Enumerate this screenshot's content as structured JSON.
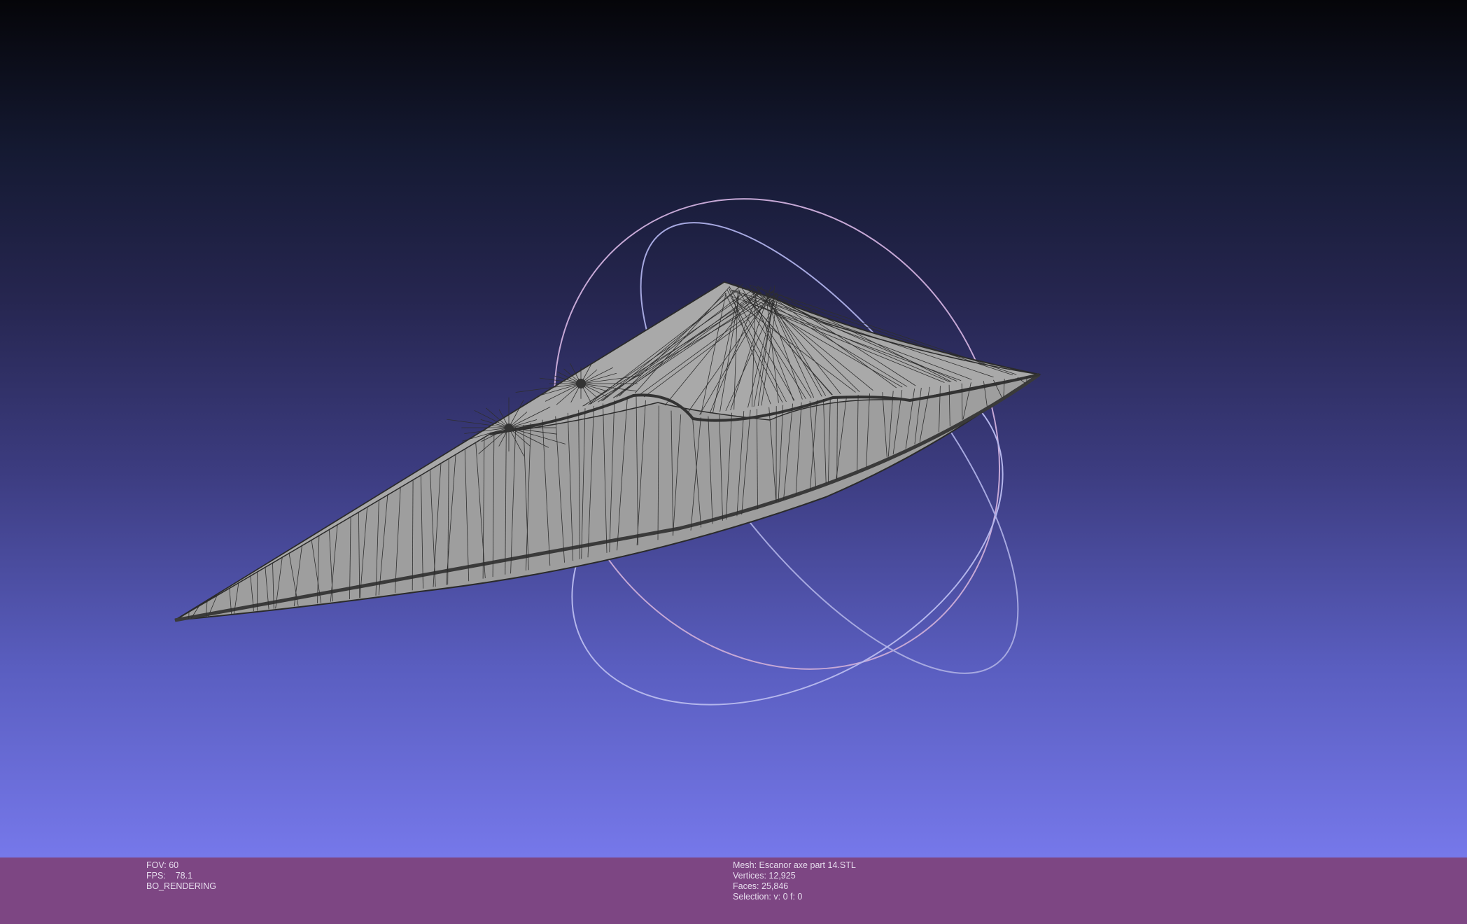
{
  "viewer": {
    "background": {
      "top_color": "#050509",
      "bottom_color": "#7678ea"
    },
    "mesh_color": "#a0a0a0",
    "wire_color": "#2e2e2e",
    "trackball_colors": [
      "#c8a0c8",
      "#a0a0d8",
      "#b8b8e8"
    ]
  },
  "info_bar": {
    "background_color": "#7d4683",
    "left": {
      "fov_label": "FOV:",
      "fov_value": "60",
      "fps_label": "FPS:",
      "fps_value": "78.1",
      "render_mode": "BO_RENDERING"
    },
    "right": {
      "mesh_label": "Mesh:",
      "mesh_name": "Escanor axe part 14.STL",
      "vertices_label": "Vertices:",
      "vertices_value": "12,925",
      "faces_label": "Faces:",
      "faces_value": "25,846",
      "selection_label": "Selection:",
      "selection_value": "v: 0 f: 0"
    }
  }
}
